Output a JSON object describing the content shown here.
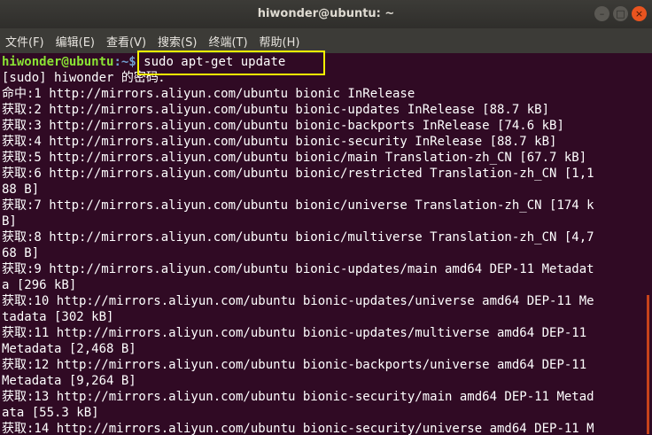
{
  "window": {
    "title": "hiwonder@ubuntu: ~",
    "buttons": {
      "minimize": "–",
      "maximize": "□",
      "close": "×"
    }
  },
  "menu": [
    "文件(F)",
    "编辑(E)",
    "查看(V)",
    "搜索(S)",
    "终端(T)",
    "帮助(H)"
  ],
  "terminal": {
    "prompt_user": "hiwonder@ubuntu",
    "prompt_path": ":~$",
    "command": " sudo apt-get update",
    "lines": [
      "[sudo] hiwonder 的密码：",
      "命中:1 http://mirrors.aliyun.com/ubuntu bionic InRelease",
      "获取:2 http://mirrors.aliyun.com/ubuntu bionic-updates InRelease [88.7 kB]",
      "获取:3 http://mirrors.aliyun.com/ubuntu bionic-backports InRelease [74.6 kB]",
      "获取:4 http://mirrors.aliyun.com/ubuntu bionic-security InRelease [88.7 kB]",
      "获取:5 http://mirrors.aliyun.com/ubuntu bionic/main Translation-zh_CN [67.7 kB]",
      "获取:6 http://mirrors.aliyun.com/ubuntu bionic/restricted Translation-zh_CN [1,1",
      "88 B]",
      "获取:7 http://mirrors.aliyun.com/ubuntu bionic/universe Translation-zh_CN [174 k",
      "B]",
      "获取:8 http://mirrors.aliyun.com/ubuntu bionic/multiverse Translation-zh_CN [4,7",
      "68 B]",
      "获取:9 http://mirrors.aliyun.com/ubuntu bionic-updates/main amd64 DEP-11 Metadat",
      "a [296 kB]",
      "获取:10 http://mirrors.aliyun.com/ubuntu bionic-updates/universe amd64 DEP-11 Me",
      "tadata [302 kB]",
      "获取:11 http://mirrors.aliyun.com/ubuntu bionic-updates/multiverse amd64 DEP-11",
      "Metadata [2,468 B]",
      "获取:12 http://mirrors.aliyun.com/ubuntu bionic-backports/universe amd64 DEP-11",
      "Metadata [9,264 B]",
      "获取:13 http://mirrors.aliyun.com/ubuntu bionic-security/main amd64 DEP-11 Metad",
      "ata [55.3 kB]",
      "获取:14 http://mirrors.aliyun.com/ubuntu bionic-security/universe amd64 DEP-11 M"
    ]
  },
  "colors": {
    "background": "#300a24",
    "highlight": "#f3f300",
    "prompt_user": "#8ae234",
    "prompt_path": "#729fcf"
  }
}
